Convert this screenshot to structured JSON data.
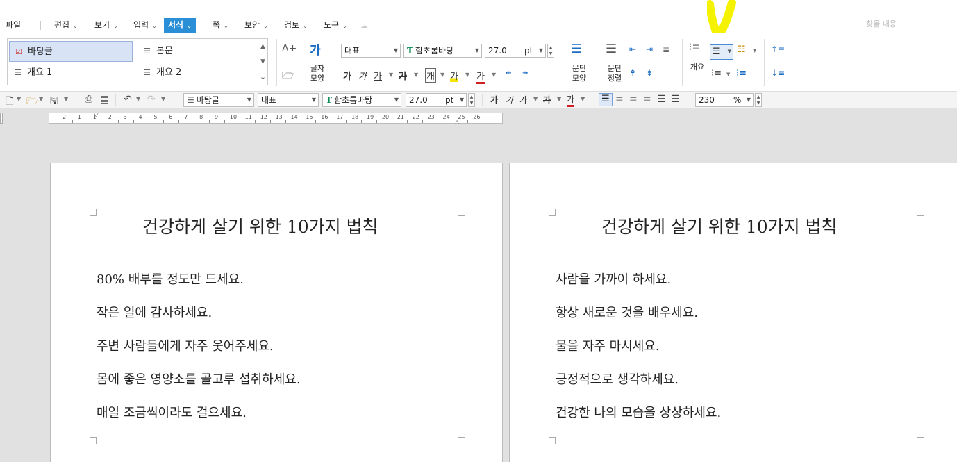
{
  "menu": {
    "items": [
      {
        "label": "파일",
        "caret": false
      },
      {
        "label": "편집",
        "caret": true
      },
      {
        "label": "보기",
        "caret": true
      },
      {
        "label": "입력",
        "caret": true
      },
      {
        "label": "서식",
        "caret": true,
        "active": true
      },
      {
        "label": "쪽",
        "caret": true
      },
      {
        "label": "보안",
        "caret": true
      },
      {
        "label": "검토",
        "caret": true
      },
      {
        "label": "도구",
        "caret": true
      }
    ],
    "caret_glyph": "⌄",
    "search_placeholder": "찾을 내용",
    "accent_color": "#2b8fd8"
  },
  "ribbon": {
    "styles": [
      {
        "label": "바탕글",
        "selected": true
      },
      {
        "label": "본문",
        "selected": false
      },
      {
        "label": "개요 1",
        "selected": false
      },
      {
        "label": "개요 2",
        "selected": false
      }
    ],
    "char_shape_label_1": "글자",
    "char_shape_label_2": "모양",
    "style_combo": "대표",
    "font_combo": "함초롬바탕",
    "font_size": "27.0",
    "font_unit": "pt",
    "bold": "가",
    "italic": "가",
    "underline": "가",
    "strike": "가",
    "box": "개",
    "highlight": "가",
    "fontcolor": "가",
    "para_shape_label_1": "문단",
    "para_shape_label_2": "모양",
    "para_align_label_1": "문단",
    "para_align_label_2": "정렬",
    "outline_label": "개요",
    "highlighter_color": "#f5f200"
  },
  "toolbar": {
    "style_combo": "바탕글",
    "repr_combo": "대표",
    "font_combo": "함초롬바탕",
    "font_size": "27.0",
    "font_unit": "pt",
    "zoom": "230",
    "zoom_unit": "%"
  },
  "ruler": {
    "ticks": [
      "2",
      "1",
      "1",
      "2",
      "3",
      "4",
      "5",
      "6",
      "7",
      "8",
      "9",
      "10",
      "11",
      "12",
      "13",
      "14",
      "15",
      "16",
      "17",
      "18",
      "19",
      "20",
      "21",
      "22",
      "23",
      "24",
      "25",
      "26"
    ]
  },
  "document": {
    "page1": {
      "title": "건강하게 살기 위한 10가지 법칙",
      "lines": [
        "80% 배부를 정도만 드세요.",
        "작은 일에 감사하세요.",
        "주변 사람들에게 자주 웃어주세요.",
        "몸에 좋은 영양소를 골고루 섭취하세요.",
        "매일 조금씩이라도 걸으세요."
      ]
    },
    "page2": {
      "title": "건강하게 살기 위한 10가지 법칙",
      "lines": [
        "사람을 가까이 하세요.",
        "항상 새로운 것을 배우세요.",
        "물을 자주 마시세요.",
        "긍정적으로 생각하세요.",
        "건강한 나의 모습을 상상하세요."
      ]
    }
  }
}
